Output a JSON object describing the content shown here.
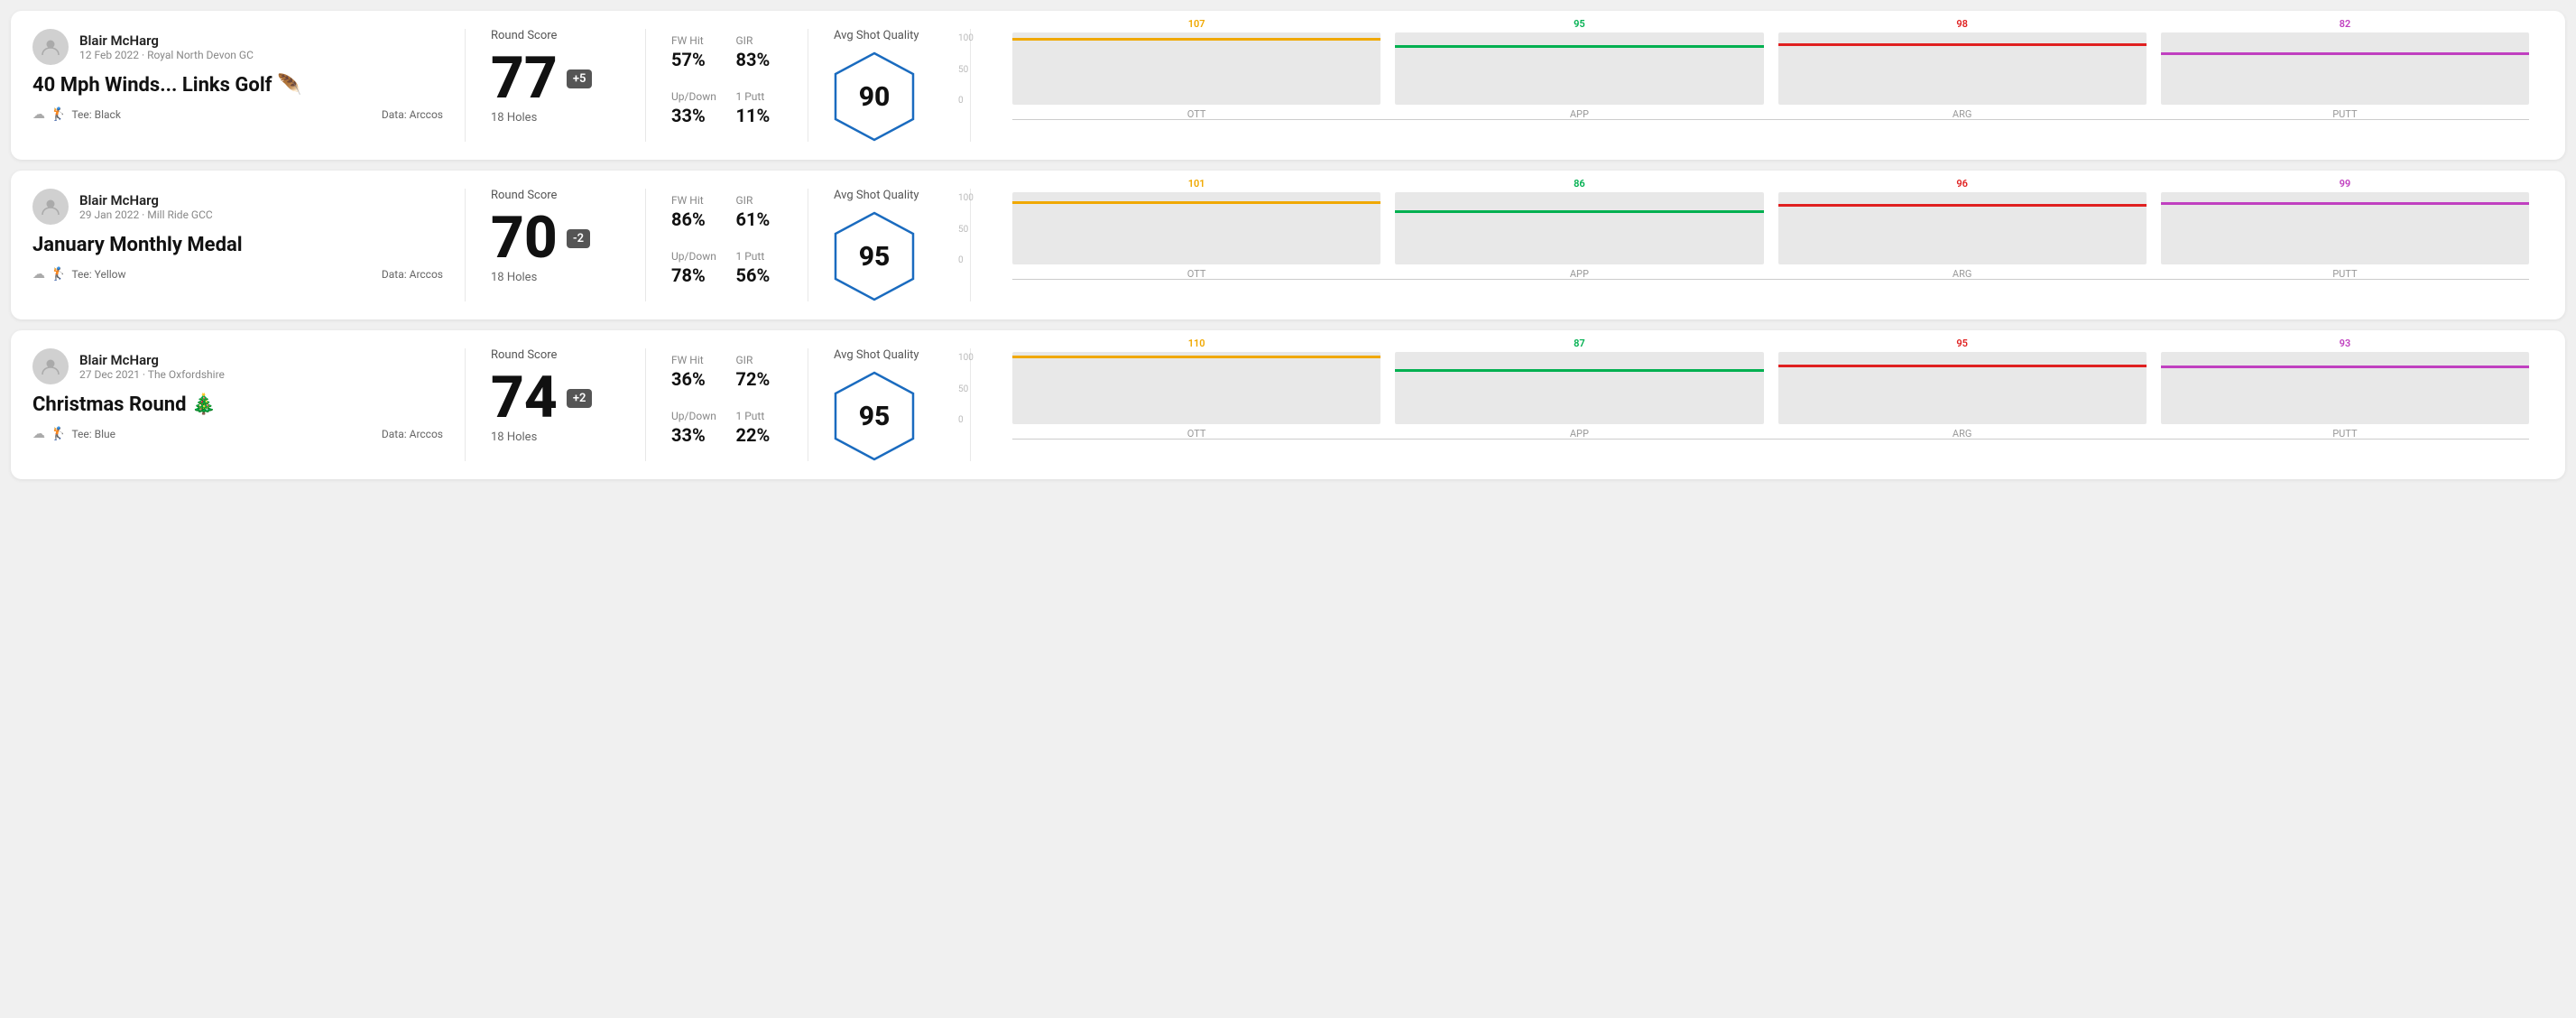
{
  "rounds": [
    {
      "player_name": "Blair McHarg",
      "date_course": "12 Feb 2022 · Royal North Devon GC",
      "round_title": "40 Mph Winds... Links Golf",
      "round_title_emoji": "🪶",
      "tee": "Black",
      "data_source": "Data: Arccos",
      "round_score_label": "Round Score",
      "score": "77",
      "score_badge": "+5",
      "score_holes": "18 Holes",
      "fw_hit_label": "FW Hit",
      "fw_hit_value": "57%",
      "gir_label": "GIR",
      "gir_value": "83%",
      "updown_label": "Up/Down",
      "updown_value": "33%",
      "oneputt_label": "1 Putt",
      "oneputt_value": "11%",
      "avg_shot_quality_label": "Avg Shot Quality",
      "quality_score": "90",
      "chart": {
        "bars": [
          {
            "label": "OTT",
            "value": 107,
            "color": "#f0a800"
          },
          {
            "label": "APP",
            "value": 95,
            "color": "#00b050"
          },
          {
            "label": "ARG",
            "value": 98,
            "color": "#e02020"
          },
          {
            "label": "PUTT",
            "value": 82,
            "color": "#c040c0"
          }
        ],
        "y_labels": [
          "100",
          "50",
          "0"
        ]
      }
    },
    {
      "player_name": "Blair McHarg",
      "date_course": "29 Jan 2022 · Mill Ride GCC",
      "round_title": "January Monthly Medal",
      "round_title_emoji": "",
      "tee": "Yellow",
      "data_source": "Data: Arccos",
      "round_score_label": "Round Score",
      "score": "70",
      "score_badge": "-2",
      "score_holes": "18 Holes",
      "fw_hit_label": "FW Hit",
      "fw_hit_value": "86%",
      "gir_label": "GIR",
      "gir_value": "61%",
      "updown_label": "Up/Down",
      "updown_value": "78%",
      "oneputt_label": "1 Putt",
      "oneputt_value": "56%",
      "avg_shot_quality_label": "Avg Shot Quality",
      "quality_score": "95",
      "chart": {
        "bars": [
          {
            "label": "OTT",
            "value": 101,
            "color": "#f0a800"
          },
          {
            "label": "APP",
            "value": 86,
            "color": "#00b050"
          },
          {
            "label": "ARG",
            "value": 96,
            "color": "#e02020"
          },
          {
            "label": "PUTT",
            "value": 99,
            "color": "#c040c0"
          }
        ],
        "y_labels": [
          "100",
          "50",
          "0"
        ]
      }
    },
    {
      "player_name": "Blair McHarg",
      "date_course": "27 Dec 2021 · The Oxfordshire",
      "round_title": "Christmas Round",
      "round_title_emoji": "🎄",
      "tee": "Blue",
      "data_source": "Data: Arccos",
      "round_score_label": "Round Score",
      "score": "74",
      "score_badge": "+2",
      "score_holes": "18 Holes",
      "fw_hit_label": "FW Hit",
      "fw_hit_value": "36%",
      "gir_label": "GIR",
      "gir_value": "72%",
      "updown_label": "Up/Down",
      "updown_value": "33%",
      "oneputt_label": "1 Putt",
      "oneputt_value": "22%",
      "avg_shot_quality_label": "Avg Shot Quality",
      "quality_score": "95",
      "chart": {
        "bars": [
          {
            "label": "OTT",
            "value": 110,
            "color": "#f0a800"
          },
          {
            "label": "APP",
            "value": 87,
            "color": "#00b050"
          },
          {
            "label": "ARG",
            "value": 95,
            "color": "#e02020"
          },
          {
            "label": "PUTT",
            "value": 93,
            "color": "#c040c0"
          }
        ],
        "y_labels": [
          "100",
          "50",
          "0"
        ]
      }
    }
  ]
}
